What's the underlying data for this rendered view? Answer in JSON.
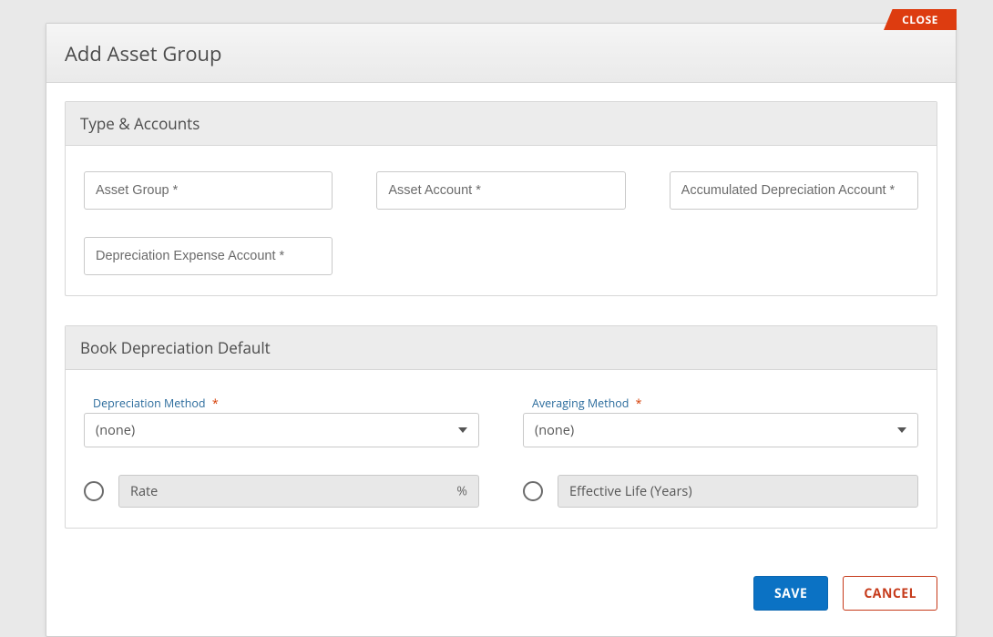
{
  "close_label": "CLOSE",
  "modal_title": "Add Asset Group",
  "panel1": {
    "title": "Type & Accounts",
    "fields": {
      "asset_group": {
        "placeholder": "Asset Group *",
        "value": ""
      },
      "asset_account": {
        "placeholder": "Asset Account *",
        "value": ""
      },
      "accum_dep_account": {
        "placeholder": "Accumulated Depreciation Account *",
        "value": ""
      },
      "dep_expense_account": {
        "placeholder": "Depreciation Expense Account *",
        "value": ""
      }
    }
  },
  "panel2": {
    "title": "Book Depreciation Default",
    "depreciation_method": {
      "label": "Depreciation Method",
      "required_mark": "*",
      "value": "(none)"
    },
    "averaging_method": {
      "label": "Averaging Method",
      "required_mark": "*",
      "value": "(none)"
    },
    "rate": {
      "label": "Rate",
      "suffix": "%",
      "selected": false
    },
    "effective_life": {
      "label": "Effective Life (Years)",
      "selected": false
    }
  },
  "buttons": {
    "save": "SAVE",
    "cancel": "CANCEL"
  }
}
